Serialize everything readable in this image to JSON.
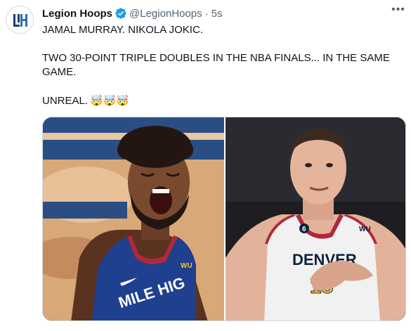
{
  "tweet": {
    "author_name": "Legion Hoops",
    "handle": "@LegionHoops",
    "separator": "·",
    "time": "5s",
    "line1": "JAMAL MURRAY. NIKOLA JOKIC.",
    "line2": "TWO 30-POINT TRIPLE DOUBLES IN THE NBA FINALS... IN THE SAME",
    "line3": "GAME.",
    "line4": "UNREAL.",
    "emojis": "🤯🤯🤯",
    "more_icon": "•••"
  },
  "media": {
    "left_jersey_text": "MILE HIG",
    "left_patch": "WU",
    "right_jersey_text": "DENVER",
    "right_number": "15",
    "right_patch_number": "6",
    "right_patch": "WU"
  },
  "colors": {
    "verified": "#1d9bf0",
    "nuggets_navy": "#0e2240",
    "nuggets_red": "#b1283a",
    "nuggets_gold": "#fec524"
  }
}
